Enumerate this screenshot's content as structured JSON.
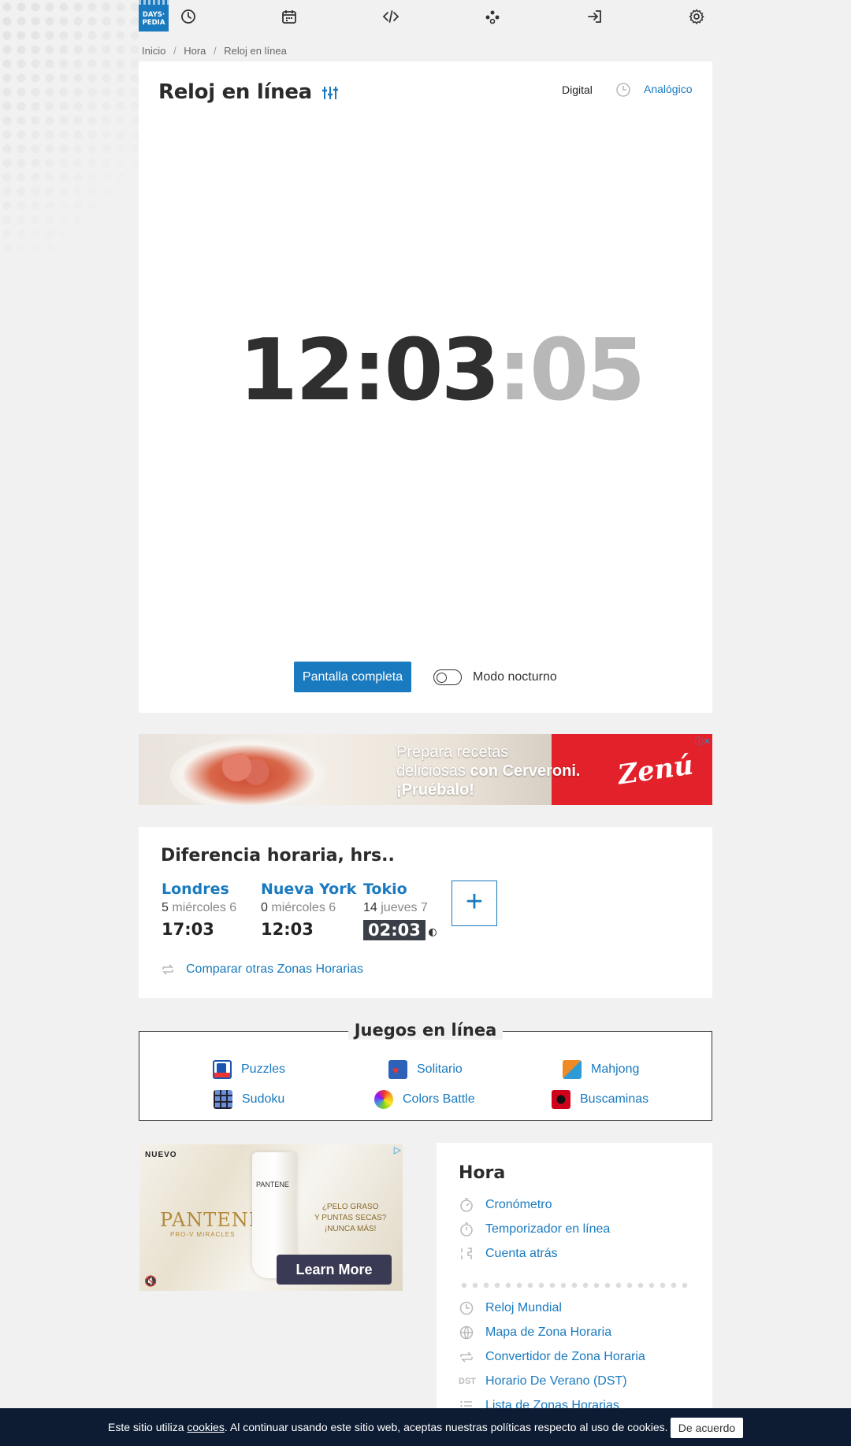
{
  "nav": {
    "logo_line1": "DAYS·",
    "logo_line2": "PEDIA",
    "icons": [
      "clock-icon",
      "calendar-icon",
      "code-icon",
      "games-icon",
      "login-icon",
      "gear-icon"
    ]
  },
  "breadcrumb": [
    "Inicio",
    "Hora",
    "Reloj en línea"
  ],
  "clock": {
    "title": "Reloj en línea",
    "mode_digital": "Digital",
    "mode_analog": "Analógico",
    "hours_minutes": "12:03",
    "seconds": ":05",
    "fullscreen_label": "Pantalla completa",
    "night_mode_label": "Modo nocturno"
  },
  "ad1": {
    "line1": "Prepara recetas",
    "line2a": "deliciosas ",
    "line2b": "con Cerveroni.",
    "line3": "¡Pruébalo!",
    "brand": "Zenú",
    "info": "ⓘ✕"
  },
  "time_difference": {
    "title": "Diferencia horaria, hrs..",
    "cities": [
      {
        "name": "Londres",
        "diff": "5",
        "day": "miércoles 6",
        "time": "17:03"
      },
      {
        "name": "Nueva York",
        "diff": "0",
        "day": "miércoles 6",
        "time": "12:03"
      },
      {
        "name": "Tokio",
        "diff": "14",
        "day": "jueves 7",
        "time": "02:03"
      }
    ],
    "add_label": "+",
    "compare_label": "Comparar otras Zonas Horarias"
  },
  "games": {
    "title": "Juegos en línea",
    "items": [
      "Puzzles",
      "Solitario",
      "Mahjong",
      "Sudoku",
      "Colors Battle",
      "Buscaminas"
    ]
  },
  "ad2": {
    "tag": "NUEVO",
    "brand": "PANTENE",
    "sub": "PRO-V MIRACLES",
    "tube_label": "PANTENE",
    "question_1": "¿PELO GRASO",
    "question_2": "Y PUNTAS SECAS?",
    "question_3": "¡NUNCA MÁS!",
    "cta": "Learn More"
  },
  "sidebar": {
    "title": "Hora",
    "links": [
      "Cronómetro",
      "Temporizador en línea",
      "Cuenta atrás",
      "Reloj Mundial",
      "Mapa de Zona Horaria",
      "Convertidor de Zona Horaria",
      "Horario De Verano (DST)",
      "Lista de Zonas Horarias"
    ],
    "dst_badge": "DST"
  },
  "cookie": {
    "text_before": "Este sitio utiliza ",
    "link": "cookies",
    "text_after": ". Al continuar usando este sitio web, aceptas nuestras políticas respecto al uso de cookies.",
    "accept": "De acuerdo"
  },
  "colors": {
    "accent": "#1a7abf",
    "cookie_bar": "#0d1c33",
    "ad_red": "#e3212a"
  }
}
